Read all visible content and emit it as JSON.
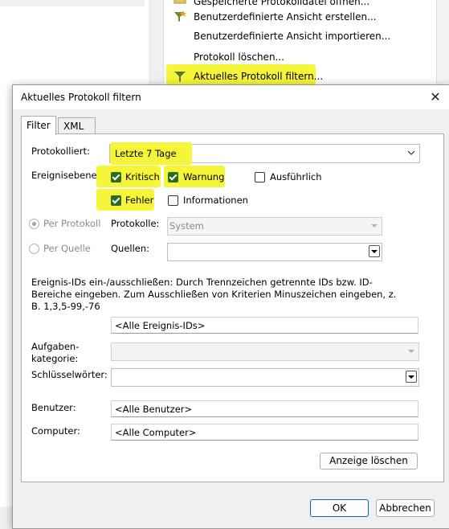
{
  "background_menu": {
    "items": [
      {
        "label": "Gespeicherte Protokolldatei öffnen..."
      },
      {
        "label": "Benutzerdefinierte Ansicht erstellen..."
      },
      {
        "label": "Benutzerdefinierte Ansicht importieren..."
      },
      {
        "label": "Protokoll löschen..."
      },
      {
        "label": "Aktuelles Protokoll filtern..."
      }
    ]
  },
  "dialog": {
    "title": "Aktuelles Protokoll filtern",
    "close_icon": "close-icon",
    "tabs": [
      {
        "label": "Filter"
      },
      {
        "label": "XML"
      }
    ],
    "protokolliert": {
      "label": "Protokolliert:",
      "value": "Letzte 7 Tage"
    },
    "ereignisebene": {
      "label": "Ereignisebene:",
      "options": [
        {
          "label": "Kritisch",
          "checked": true
        },
        {
          "label": "Warnung",
          "checked": true
        },
        {
          "label": "Ausführlich",
          "checked": false
        },
        {
          "label": "Fehler",
          "checked": true
        },
        {
          "label": "Informationen",
          "checked": false
        }
      ]
    },
    "per_protokoll": {
      "label": "Per Protokoll"
    },
    "per_quelle": {
      "label": "Per Quelle"
    },
    "protokolle": {
      "label": "Protokolle:",
      "value": "System"
    },
    "quellen": {
      "label": "Quellen:",
      "value": ""
    },
    "description": "Ereignis-IDs ein-/ausschließen: Durch Trennzeichen getrennte IDs bzw. ID-Bereiche eingeben. Zum Ausschließen von Kriterien Minuszeichen eingeben, z. B. 1,3,5-99,-76",
    "ereignis_ids": {
      "value": "<Alle Ereignis-IDs>"
    },
    "aufgabenkategorie": {
      "label_line1": "Aufgaben-",
      "label_line2": "kategorie:",
      "value": ""
    },
    "schluesselwoerter": {
      "label": "Schlüsselwörter:",
      "value": ""
    },
    "benutzer": {
      "label": "Benutzer:",
      "value": "<Alle Benutzer>"
    },
    "computer": {
      "label": "Computer:",
      "value": "<Alle Computer>"
    },
    "clear_button": "Anzeige löschen",
    "ok_button": "OK",
    "cancel_button": "Abbrechen"
  },
  "colors": {
    "highlight": "#f5f53a",
    "check_green": "#2e6b22",
    "ok_border": "#0067c0"
  }
}
